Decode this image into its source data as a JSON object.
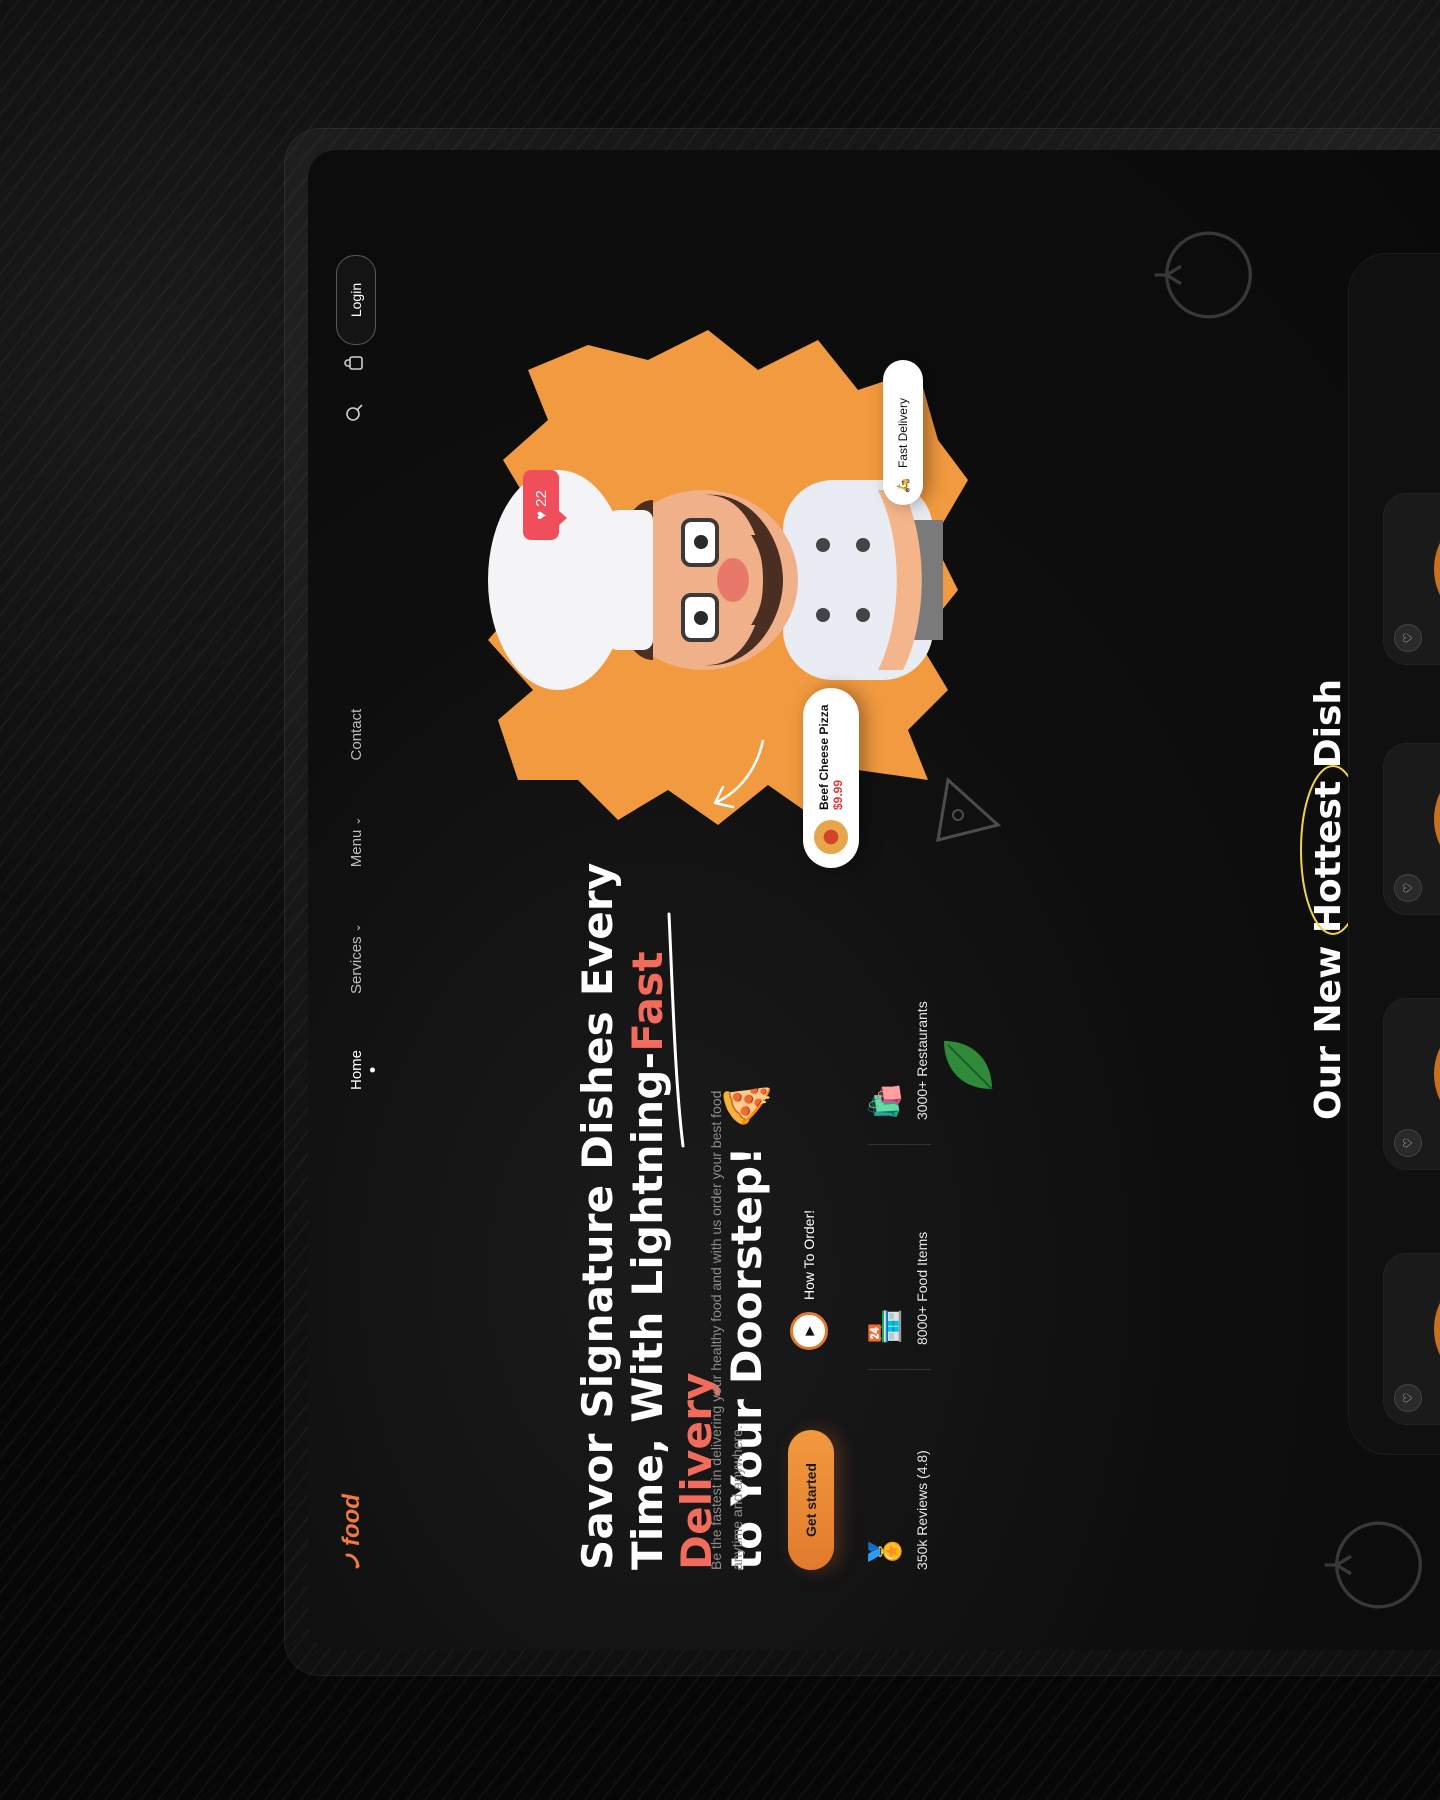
{
  "brand": {
    "logo_text": "food",
    "accent_color": "#f27a3a",
    "highlight_color": "#f26b5b"
  },
  "nav": {
    "items": [
      {
        "label": "Home",
        "active": true
      },
      {
        "label": "Services",
        "dropdown": true
      },
      {
        "label": "Menu",
        "dropdown": true
      },
      {
        "label": "Contact"
      }
    ],
    "chevron": "⌄",
    "search_icon": "search-icon",
    "cart_icon": "shopping-bag-icon",
    "login_label": "Login"
  },
  "hero": {
    "headline_line1": "Savor Signature Dishes Every",
    "headline_line2_start": "Time, With Lightning-",
    "headline_line2_accent": "Fast Delivery",
    "headline_line3": "to Your Doorstep!",
    "headline_emoji": "🍕",
    "description": "Be the fastest in delivering your healthy food and with us order your best food anytime and anywhere.",
    "cta_label": "Get started",
    "how_to_label": "How To Order!"
  },
  "stats": [
    {
      "icon": "medal-icon",
      "emoji": "🏅",
      "text": "350k Reviews (4.8)"
    },
    {
      "icon": "store-icon",
      "emoji": "🏪",
      "text": "8000+ Food Items"
    },
    {
      "icon": "grocery-bag-icon",
      "emoji": "🛍️",
      "text": "3000+ Restaurants"
    }
  ],
  "illustration": {
    "like_count": "22",
    "product_chip": {
      "name": "Beef Cheese Pizza",
      "price": "$9.99"
    },
    "delivery_chip": {
      "label": "Fast Delivery",
      "icon": "scooter-icon"
    },
    "splash_color": "#f29a3f"
  },
  "section": {
    "title_prefix": "Our New ",
    "title_highlight": "Hottest",
    "title_suffix": " Dish"
  },
  "dish_cards": [
    {
      "fav_icon": "heart-icon"
    },
    {
      "fav_icon": "heart-icon"
    },
    {
      "fav_icon": "heart-icon"
    },
    {
      "fav_icon": "heart-icon"
    }
  ]
}
